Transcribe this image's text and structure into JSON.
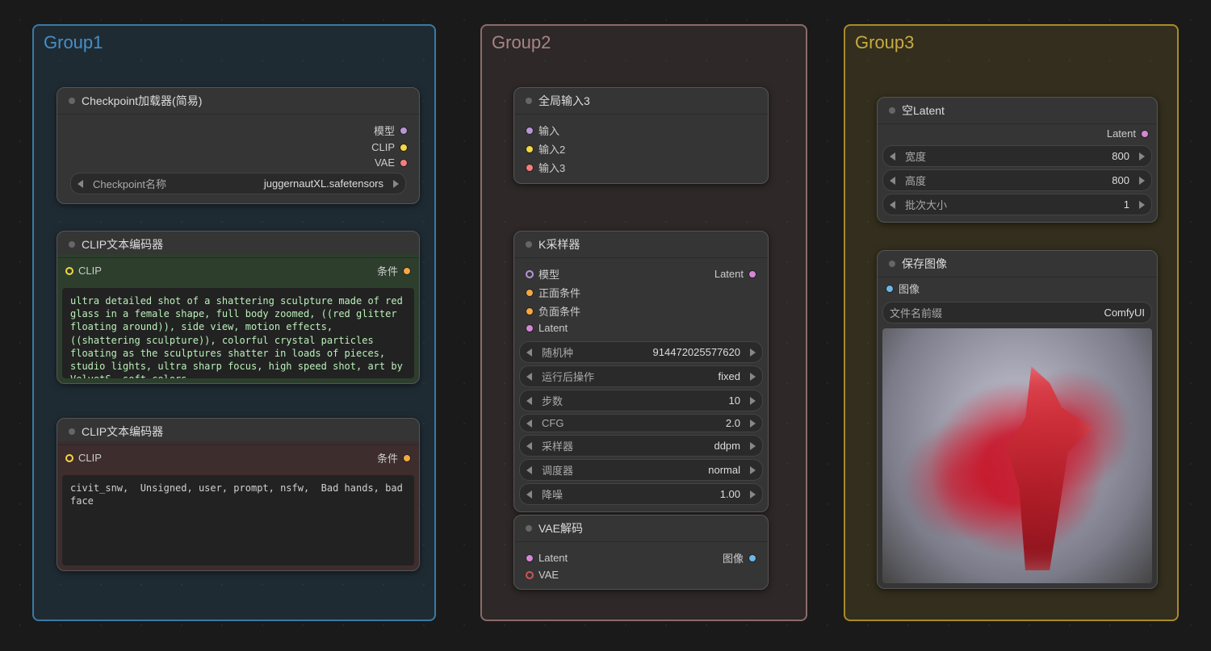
{
  "groups": {
    "g1": {
      "title": "Group1"
    },
    "g2": {
      "title": "Group2"
    },
    "g3": {
      "title": "Group3"
    }
  },
  "checkpoint": {
    "title": "Checkpoint加载器(简易)",
    "outputs": {
      "model": "模型",
      "clip": "CLIP",
      "vae": "VAE"
    },
    "widget_label": "Checkpoint名称",
    "widget_value": "juggernautXL.safetensors"
  },
  "clip_pos": {
    "title": "CLIP文本编码器",
    "input": "CLIP",
    "output": "条件",
    "text": "ultra detailed shot of a shattering sculpture made of red glass in a female shape, full body zoomed, ((red glitter floating around)), side view, motion effects, ((shattering sculpture)), colorful crystal particles floating as the sculptures shatter in loads of pieces, studio lights, ultra sharp focus, high speed shot, art by VelvetS, soft colors,"
  },
  "clip_neg": {
    "title": "CLIP文本编码器",
    "input": "CLIP",
    "output": "条件",
    "text": "civit_snw,  Unsigned, user, prompt, nsfw,  Bad hands, bad face"
  },
  "global_in": {
    "title": "全局输入3",
    "in1": "输入",
    "in2": "输入2",
    "in3": "输入3"
  },
  "ksampler": {
    "title": "K采样器",
    "in_model": "模型",
    "in_pos": "正面条件",
    "in_neg": "负面条件",
    "in_latent": "Latent",
    "out_latent": "Latent",
    "seed_l": "随机种",
    "seed_v": "914472025577620",
    "after_l": "运行后操作",
    "after_v": "fixed",
    "steps_l": "步数",
    "steps_v": "10",
    "cfg_l": "CFG",
    "cfg_v": "2.0",
    "sampler_l": "采样器",
    "sampler_v": "ddpm",
    "sched_l": "调度器",
    "sched_v": "normal",
    "denoise_l": "降噪",
    "denoise_v": "1.00"
  },
  "vae_decode": {
    "title": "VAE解码",
    "in_latent": "Latent",
    "in_vae": "VAE",
    "out_image": "图像"
  },
  "empty_latent": {
    "title": "空Latent",
    "out": "Latent",
    "w_l": "宽度",
    "w_v": "800",
    "h_l": "高度",
    "h_v": "800",
    "b_l": "批次大小",
    "b_v": "1"
  },
  "save": {
    "title": "保存图像",
    "in": "图像",
    "pref_l": "文件名前缀",
    "pref_v": "ComfyUI"
  }
}
